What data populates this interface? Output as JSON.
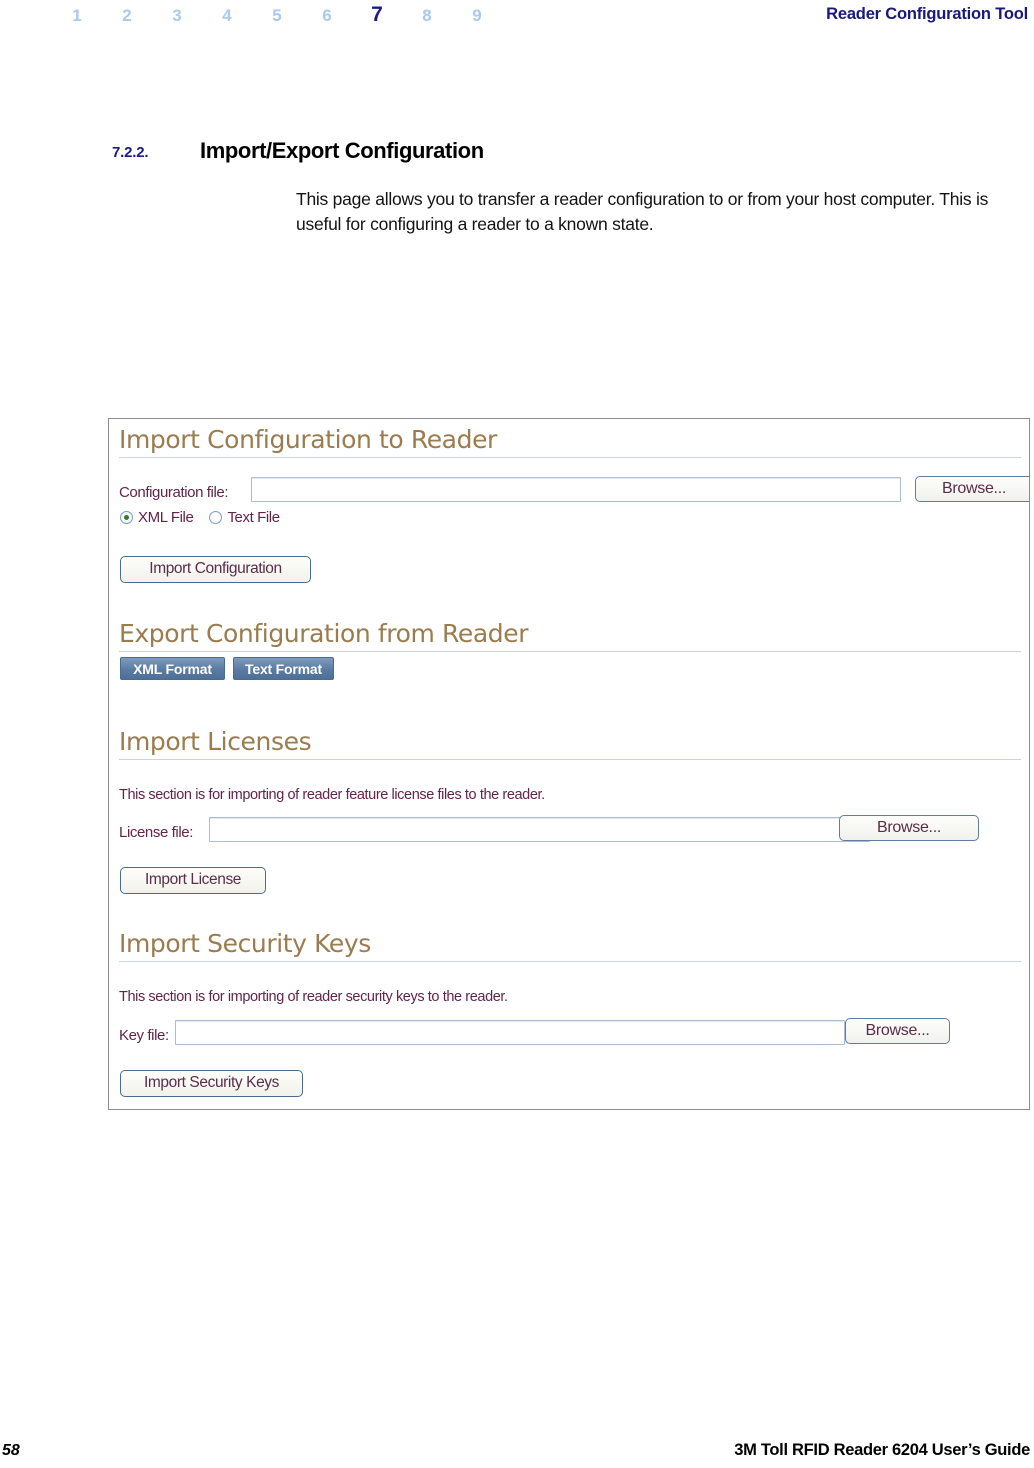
{
  "header": {
    "chapters": [
      "1",
      "2",
      "3",
      "4",
      "5",
      "6",
      "7",
      "8",
      "9"
    ],
    "current_chapter": "7",
    "title": "Reader Configuration Tool"
  },
  "section": {
    "number": "7.2.2.",
    "title": "Import/Export Configuration",
    "body": "This page allows you to transfer a reader configuration to or from your host computer. This is useful for configuring a reader to a known state."
  },
  "screenshot": {
    "import_config": {
      "heading": "Import Configuration to Reader",
      "file_label": "Configuration file:",
      "file_value": "",
      "browse_label": "Browse...",
      "radios": [
        {
          "label": "XML File",
          "checked": true
        },
        {
          "label": "Text File",
          "checked": false
        }
      ],
      "submit_label": "Import Configuration"
    },
    "export_config": {
      "heading": "Export Configuration from Reader",
      "buttons": [
        "XML Format",
        "Text Format"
      ]
    },
    "import_licenses": {
      "heading": "Import Licenses",
      "note": "This section is for importing of reader feature license files to the reader.",
      "file_label": "License file:",
      "file_value": "",
      "browse_label": "Browse...",
      "submit_label": "Import License"
    },
    "import_security_keys": {
      "heading": "Import Security Keys",
      "note": "This section is for importing of reader security keys to the reader.",
      "file_label": "Key file:",
      "file_value": "",
      "browse_label": "Browse...",
      "submit_label": "Import Security Keys"
    }
  },
  "footer": {
    "page_number": "58",
    "guide_title": "3M Toll RFID Reader 6204 User’s Guide"
  },
  "colors": {
    "chapter_inactive": "#a8c9f0",
    "chapter_active": "#1a1a8c",
    "header_title": "#18187e",
    "section_number": "#1a1a8c",
    "panel_heading": "#9a7c4e",
    "panel_label": "#63234a",
    "format_button": "#5a7ba3"
  }
}
